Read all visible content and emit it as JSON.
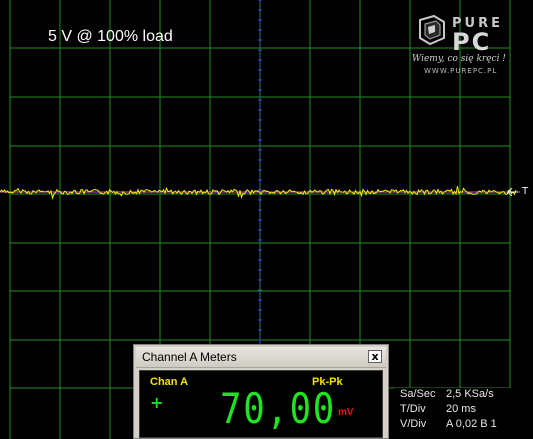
{
  "overlay": {
    "title": "5 V @ 100% load",
    "trigger_marker": "T"
  },
  "logo": {
    "pure": "PURE",
    "pc": "PC",
    "tagline": "Wiemy, co się kręci !",
    "url": "WWW.PUREPC.PL"
  },
  "colors": {
    "background": "#000000",
    "grid": "#1f8f1f",
    "center_axis": "#3a4fd0",
    "trace": "#f2f000",
    "trace_baseline": "#d050d0",
    "meter_digits": "#21e421",
    "meter_label": "#f4e000",
    "meter_unit": "#e01818"
  },
  "meter": {
    "window_title": "Channel A Meters",
    "close_glyph": "x",
    "channel": "Chan A",
    "measurement": "Pk-Pk",
    "sign": "+",
    "value": "70,00",
    "unit": "mV"
  },
  "info": {
    "rows": [
      {
        "key": "Sa/Sec",
        "value": "2,5 KSa/s"
      },
      {
        "key": "T/Div",
        "value": "20 ms"
      },
      {
        "key": "V/Div",
        "value": "A 0,02     B 1"
      }
    ]
  }
}
